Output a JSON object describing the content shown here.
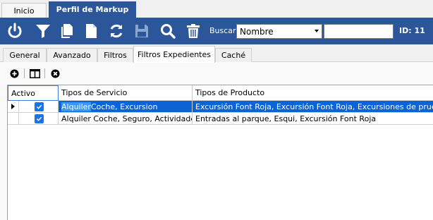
{
  "top_tabs": {
    "home": "Inicio",
    "markup": "Perfil de Markup"
  },
  "toolbar": {
    "icons": [
      "power-icon",
      "filter-icon",
      "copy-icon",
      "new-document-icon",
      "refresh-icon",
      "save-icon",
      "search-icon",
      "delete-icon"
    ],
    "buscar_label": "Buscar",
    "buscar_selected": "Nombre",
    "buscar_value": "",
    "id_label": "ID: 11"
  },
  "sub_tabs": [
    "General",
    "Avanzado",
    "Filtros",
    "Filtros Expedientes",
    "Caché"
  ],
  "active_sub_tab": "Filtros Expedientes",
  "mini_toolbar": [
    "add-icon",
    "columns-icon",
    "remove-icon"
  ],
  "grid": {
    "columns": [
      "Activo",
      "Tipos de Servicio",
      "Tipos de Producto"
    ],
    "rows": [
      {
        "active": true,
        "servicio_prefix": "Alquiler",
        "servicio_rest": " Coche, Excursion",
        "producto": "Excursión Font Roja, Excursión Font Roja, Excursiones de prueba"
      },
      {
        "active": true,
        "servicio": "Alquiler Coche, Seguro, Actividades",
        "producto": "Entradas al parque, Esqui, Excursión Font Roja"
      }
    ]
  },
  "colors": {
    "accent": "#2b579a",
    "selection": "#0a64d6"
  }
}
